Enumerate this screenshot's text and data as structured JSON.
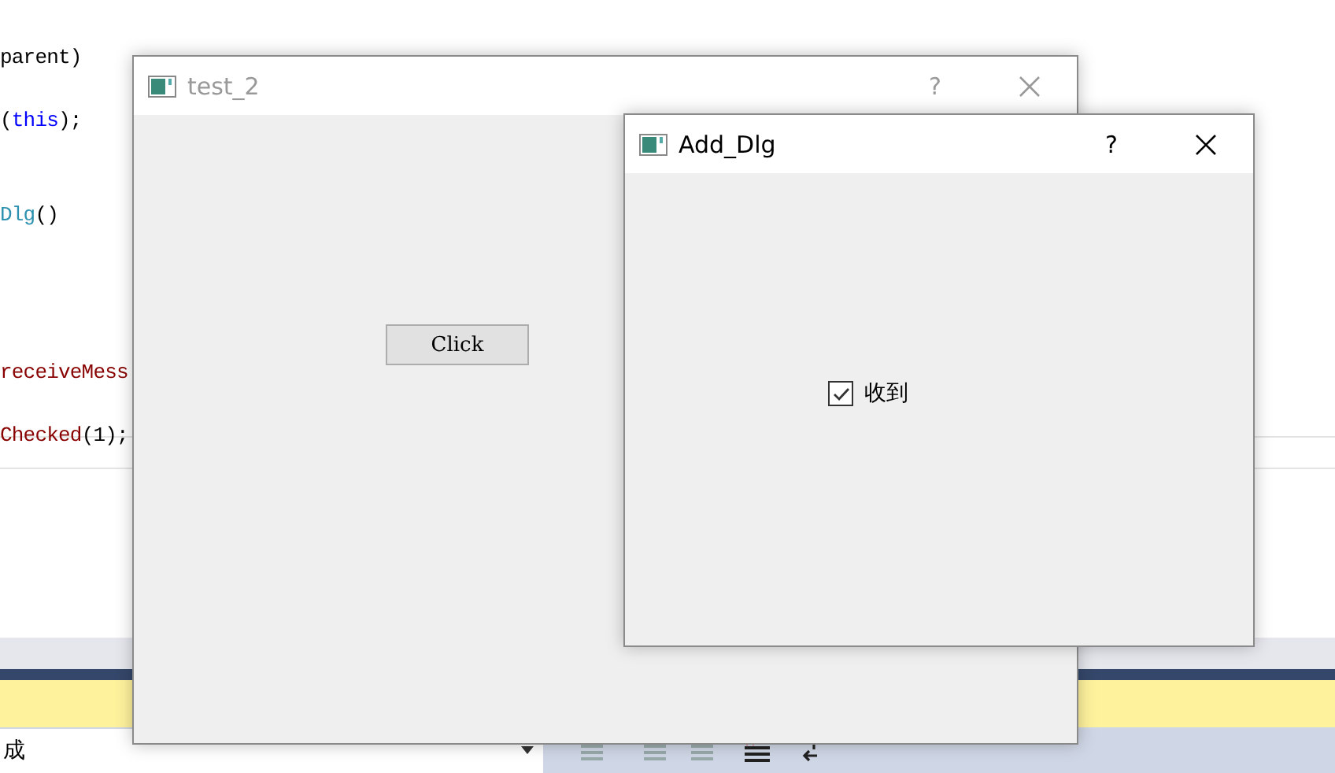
{
  "editor": {
    "lines": [
      {
        "segments": [
          {
            "text": "parent)"
          }
        ]
      },
      {
        "segments": [
          {
            "text": "("
          },
          {
            "text": "this",
            "color": "#0000ff"
          },
          {
            "text": ");"
          }
        ]
      },
      {
        "segments": [
          {
            "text": "Dlg",
            "color": "#2b91af"
          },
          {
            "text": "()"
          }
        ]
      },
      {
        "segments": [
          {
            "text": "receiveMess",
            "color": "#880000"
          }
        ]
      },
      {
        "segments": [
          {
            "text": "Checked",
            "color": "#880000"
          },
          {
            "text": "(1);"
          }
        ]
      }
    ]
  },
  "bottom_bar": {
    "combo_value": "成"
  },
  "windows": [
    {
      "title": "test_2",
      "active": false,
      "help": "?",
      "content": {
        "kind": "button",
        "label": "Click"
      }
    },
    {
      "title": "Add_Dlg",
      "active": true,
      "help": "?",
      "content": {
        "kind": "checkbox",
        "label": "收到",
        "checked": true
      }
    }
  ]
}
